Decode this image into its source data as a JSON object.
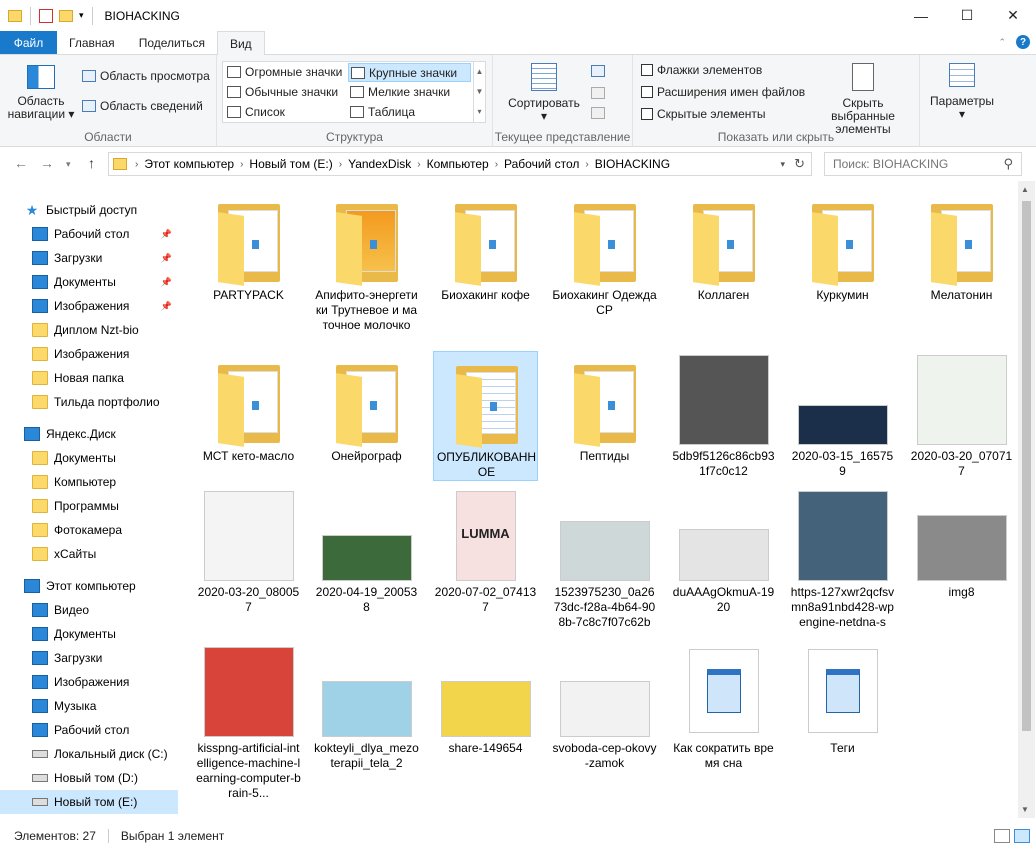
{
  "window": {
    "title": "BIOHACKING",
    "minimize": "—",
    "maximize": "☐",
    "close": "✕"
  },
  "ribbon_tabs": [
    {
      "label": "Файл"
    },
    {
      "label": "Главная"
    },
    {
      "label": "Поделиться"
    },
    {
      "label": "Вид"
    }
  ],
  "ribbon": {
    "panes": {
      "nav_pane": "Область навигации",
      "preview_pane": "Область просмотра",
      "details_pane": "Область сведений",
      "label": "Области"
    },
    "layout": {
      "items": [
        "Огромные значки",
        "Крупные значки",
        "Обычные значки",
        "Мелкие значки",
        "Список",
        "Таблица"
      ],
      "selected": "Крупные значки",
      "label": "Структура"
    },
    "current_view": {
      "sort": "Сортировать",
      "label": "Текущее представление"
    },
    "show_hide": {
      "item_checkboxes": "Флажки элементов",
      "file_extensions": "Расширения имен файлов",
      "hidden_items": "Скрытые элементы",
      "hide_selected": "Скрыть выбранные элементы",
      "label": "Показать или скрыть"
    },
    "options": "Параметры"
  },
  "address": {
    "crumbs": [
      "Этот компьютер",
      "Новый том (E:)",
      "YandexDisk",
      "Компьютер",
      "Рабочий стол",
      "BIOHACKING"
    ],
    "search_placeholder": "Поиск: BIOHACKING"
  },
  "sidebar": {
    "items": [
      {
        "label": "Быстрый доступ",
        "icon": "star-icon",
        "level": 0,
        "pin": false
      },
      {
        "label": "Рабочий стол",
        "icon": "desktop-icon",
        "level": 1,
        "pin": true
      },
      {
        "label": "Загрузки",
        "icon": "download-icon",
        "level": 1,
        "pin": true
      },
      {
        "label": "Документы",
        "icon": "documents-icon",
        "level": 1,
        "pin": true
      },
      {
        "label": "Изображения",
        "icon": "pictures-icon",
        "level": 1,
        "pin": true
      },
      {
        "label": "Диплом Nzt-bio",
        "icon": "folder-icon",
        "level": 1,
        "pin": false
      },
      {
        "label": "Изображения",
        "icon": "folder-icon",
        "level": 1,
        "pin": false
      },
      {
        "label": "Новая папка",
        "icon": "folder-icon",
        "level": 1,
        "pin": false
      },
      {
        "label": "Тильда портфолио",
        "icon": "folder-icon",
        "level": 1,
        "pin": false
      },
      {
        "label": "Яндекс.Диск",
        "icon": "yandex-disk-icon",
        "level": 0,
        "pin": false
      },
      {
        "label": "Документы",
        "icon": "folder-icon",
        "level": 1,
        "pin": false
      },
      {
        "label": "Компьютер",
        "icon": "folder-icon",
        "level": 1,
        "pin": false
      },
      {
        "label": "Программы",
        "icon": "folder-icon",
        "level": 1,
        "pin": false
      },
      {
        "label": "Фотокамера",
        "icon": "folder-icon",
        "level": 1,
        "pin": false
      },
      {
        "label": "хСайты",
        "icon": "folder-icon",
        "level": 1,
        "pin": false
      },
      {
        "label": "Этот компьютер",
        "icon": "computer-icon",
        "level": 0,
        "pin": false
      },
      {
        "label": "Видео",
        "icon": "video-icon",
        "level": 1,
        "pin": false
      },
      {
        "label": "Документы",
        "icon": "documents-icon",
        "level": 1,
        "pin": false
      },
      {
        "label": "Загрузки",
        "icon": "download-icon",
        "level": 1,
        "pin": false
      },
      {
        "label": "Изображения",
        "icon": "pictures-icon",
        "level": 1,
        "pin": false
      },
      {
        "label": "Музыка",
        "icon": "music-icon",
        "level": 1,
        "pin": false
      },
      {
        "label": "Рабочий стол",
        "icon": "desktop-icon",
        "level": 1,
        "pin": false
      },
      {
        "label": "Локальный диск (C:)",
        "icon": "drive-icon",
        "level": 1,
        "pin": false
      },
      {
        "label": "Новый том (D:)",
        "icon": "drive-icon",
        "level": 1,
        "pin": false
      },
      {
        "label": "Новый том (E:)",
        "icon": "drive-icon",
        "level": 1,
        "pin": false,
        "selected": true
      }
    ]
  },
  "files": [
    {
      "name": "PARTYPACK",
      "type": "folder"
    },
    {
      "name": "Апифито-энергетики Трутневое и маточное молочко",
      "type": "folder-image"
    },
    {
      "name": "Биохакинг кофе",
      "type": "folder"
    },
    {
      "name": "Биохакинг Одежда СР",
      "type": "folder"
    },
    {
      "name": "Коллаген",
      "type": "folder"
    },
    {
      "name": "Куркумин",
      "type": "folder"
    },
    {
      "name": "Мелатонин",
      "type": "folder"
    },
    {
      "name": "МСТ кето-масло",
      "type": "folder"
    },
    {
      "name": "Онейрограф",
      "type": "folder"
    },
    {
      "name": "ОПУБЛИКОВАННОЕ",
      "type": "folder-docs",
      "selected": true
    },
    {
      "name": "Пептиды",
      "type": "folder"
    },
    {
      "name": "5db9f5126c86cb931f7c0c12",
      "type": "image",
      "color": "#555555"
    },
    {
      "name": "2020-03-15_165759",
      "type": "image",
      "color": "#1c2f4a"
    },
    {
      "name": "2020-03-20_070717",
      "type": "image",
      "color": "#eef3ee"
    },
    {
      "name": "2020-03-20_080057",
      "type": "image",
      "color": "#f4f4f4"
    },
    {
      "name": "2020-04-19_200538",
      "type": "image",
      "color": "#3d6a3a"
    },
    {
      "name": "2020-07-02_074137",
      "type": "image",
      "color": "#f6e0e0",
      "overlay": "LUMMA"
    },
    {
      "name": "1523975230_0a2673dc-f28a-4b64-908b-7c8c7f07c62b",
      "type": "image",
      "color": "#cfd8d8"
    },
    {
      "name": "duAAAgOkmuA-1920",
      "type": "image",
      "color": "#e4e4e4"
    },
    {
      "name": "https-127xwr2qcfsvmn8a91nbd428-wpengine-netdna-s",
      "type": "image",
      "color": "#44627a"
    },
    {
      "name": "img8",
      "type": "image",
      "color": "#8a8a8a"
    },
    {
      "name": "kisspng-artificial-intelligence-machine-learning-computer-brain-5...",
      "type": "image",
      "color": "#d9443a"
    },
    {
      "name": "kokteyli_dlya_mezoterapii_tela_2",
      "type": "image",
      "color": "#9fd2e6"
    },
    {
      "name": "share-149654",
      "type": "image",
      "color": "#f2d54a"
    },
    {
      "name": "svoboda-cep-okovy-zamok",
      "type": "image",
      "color": "#f2f2f2"
    },
    {
      "name": "Как сократить время сна",
      "type": "text"
    },
    {
      "name": "Теги",
      "type": "text"
    }
  ],
  "status": {
    "count": "Элементов: 27",
    "selection": "Выбран 1 элемент"
  }
}
